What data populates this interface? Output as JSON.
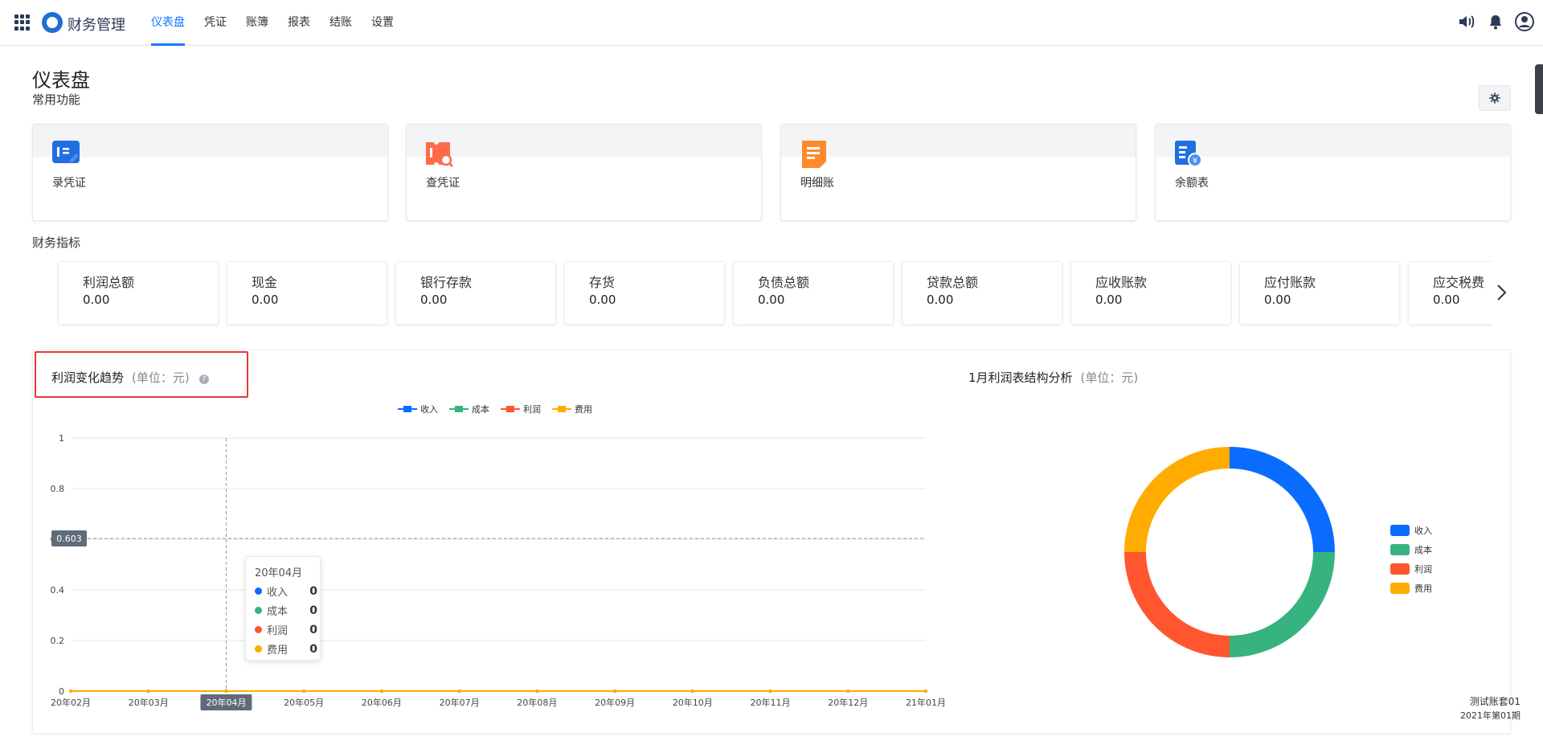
{
  "app": {
    "title": "财务管理",
    "nav": [
      "仪表盘",
      "凭证",
      "账簿",
      "报表",
      "结账",
      "设置"
    ]
  },
  "page": {
    "title": "仪表盘",
    "common_functions_label": "常用功能",
    "indicators_label": "财务指标"
  },
  "functions": [
    {
      "label": "录凭证",
      "icon": "voucher-entry-icon",
      "color": "#1f6fe0"
    },
    {
      "label": "查凭证",
      "icon": "voucher-search-icon",
      "color": "#ff6b4a"
    },
    {
      "label": "明细账",
      "icon": "ledger-detail-icon",
      "color": "#ff8a2b"
    },
    {
      "label": "余额表",
      "icon": "balance-sheet-icon",
      "color": "#1f6fe0"
    }
  ],
  "metrics": [
    {
      "name": "利润总额",
      "value": "0.00"
    },
    {
      "name": "现金",
      "value": "0.00"
    },
    {
      "name": "银行存款",
      "value": "0.00"
    },
    {
      "name": "存货",
      "value": "0.00"
    },
    {
      "name": "负债总额",
      "value": "0.00"
    },
    {
      "name": "贷款总额",
      "value": "0.00"
    },
    {
      "name": "应收账款",
      "value": "0.00"
    },
    {
      "name": "应付账款",
      "value": "0.00"
    },
    {
      "name": "应交税费",
      "value": "0.00"
    }
  ],
  "trend": {
    "title": "利润变化趋势",
    "unit": "(单位：元)",
    "help": "?",
    "crosshair_value": "0.603",
    "tooltip": {
      "title": "20年04月",
      "rows": [
        {
          "name": "收入",
          "value": "0"
        },
        {
          "name": "成本",
          "value": "0"
        },
        {
          "name": "利润",
          "value": "0"
        },
        {
          "name": "费用",
          "value": "0"
        }
      ]
    }
  },
  "structure": {
    "title": "1月利润表结构分析",
    "unit": "(单位：元)"
  },
  "colors": {
    "收入": "#0a6cff",
    "成本": "#36b37e",
    "利润": "#ff5630",
    "费用": "#ffab00",
    "accent": "#1677ff"
  },
  "chart_data": [
    {
      "type": "line",
      "title": "利润变化趋势",
      "categories": [
        "20年02月",
        "20年03月",
        "20年04月",
        "20年05月",
        "20年06月",
        "20年07月",
        "20年08月",
        "20年09月",
        "20年10月",
        "20年11月",
        "20年12月",
        "21年01月"
      ],
      "series": [
        {
          "name": "收入",
          "values": [
            0,
            0,
            0,
            0,
            0,
            0,
            0,
            0,
            0,
            0,
            0,
            0
          ]
        },
        {
          "name": "成本",
          "values": [
            0,
            0,
            0,
            0,
            0,
            0,
            0,
            0,
            0,
            0,
            0,
            0
          ]
        },
        {
          "name": "利润",
          "values": [
            0,
            0,
            0,
            0,
            0,
            0,
            0,
            0,
            0,
            0,
            0,
            0
          ]
        },
        {
          "name": "费用",
          "values": [
            0,
            0,
            0,
            0,
            0,
            0,
            0,
            0,
            0,
            0,
            0,
            0
          ]
        }
      ],
      "yticks": [
        "0",
        "0.2",
        "0.4",
        "0.6",
        "0.8",
        "1"
      ],
      "ylim": [
        0,
        1
      ],
      "grid": true,
      "legend": "top-center",
      "highlighted_category": "20年04月"
    },
    {
      "type": "pie",
      "title": "1月利润表结构分析",
      "style": "donut",
      "labels": [
        "收入",
        "成本",
        "利润",
        "费用"
      ],
      "values": [
        1,
        1,
        1,
        1
      ],
      "legend": "right"
    }
  ],
  "footer": {
    "account": "测试账套01",
    "period": "2021年第01期"
  }
}
